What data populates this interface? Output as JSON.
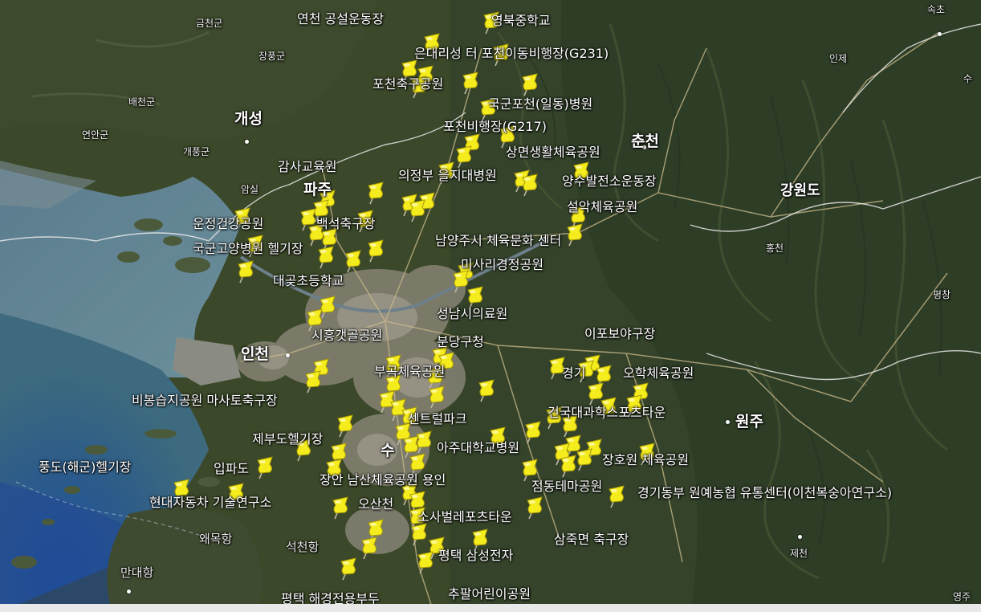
{
  "map": {
    "region_labels": [
      {
        "id": "sokcho",
        "text": "속초"
      },
      {
        "id": "inje",
        "text": "인제"
      },
      {
        "id": "yangpyeong",
        "text": "수"
      },
      {
        "id": "geumcheon",
        "text": "금천군"
      },
      {
        "id": "jangpung",
        "text": "장풍군"
      },
      {
        "id": "baecheon",
        "text": "배천군"
      },
      {
        "id": "yeonan",
        "text": "연안군"
      },
      {
        "id": "gaepung",
        "text": "개풍군"
      },
      {
        "id": "gaeseong",
        "text": "개성"
      },
      {
        "id": "chuncheon",
        "text": "춘천"
      },
      {
        "id": "gangwon",
        "text": "강원도"
      },
      {
        "id": "hongcheon",
        "text": "홍천"
      },
      {
        "id": "pyeongchang",
        "text": "평창"
      },
      {
        "id": "incheon",
        "text": "인천"
      },
      {
        "id": "wonju",
        "text": "원주"
      },
      {
        "id": "jecheon",
        "text": "제천"
      },
      {
        "id": "yeongju",
        "text": "영주"
      },
      {
        "id": "paju",
        "text": "파주"
      },
      {
        "id": "samsan",
        "text": "암실"
      },
      {
        "id": "suwon",
        "text": "수"
      }
    ],
    "poi_labels": [
      {
        "id": "yeoncheon",
        "text": "연천 공설운동장"
      },
      {
        "id": "yeongbuk",
        "text": "영북중학교"
      },
      {
        "id": "pocheon-g231",
        "text": "은대리성 터 포천이동비행장(G231)"
      },
      {
        "id": "pocheon-park",
        "text": "포천축구공원"
      },
      {
        "id": "army-hospital-pocheon",
        "text": "국군포천(일동)병원"
      },
      {
        "id": "pocheon-g217",
        "text": "포천비행장(G217)"
      },
      {
        "id": "sangmyeon",
        "text": "상면생활체육공원"
      },
      {
        "id": "gamsa",
        "text": "감사교육원"
      },
      {
        "id": "uijeongbu",
        "text": "의정부 을지대병원"
      },
      {
        "id": "yangsu",
        "text": "양수발전소운동장"
      },
      {
        "id": "seorak",
        "text": "설악체육공원"
      },
      {
        "id": "unjeong",
        "text": "운정건강공원"
      },
      {
        "id": "baekseok",
        "text": "백석축구장"
      },
      {
        "id": "namyangju",
        "text": "남양주시 체육문화 센터"
      },
      {
        "id": "goyang-heli",
        "text": "국군고양병원 헬기장"
      },
      {
        "id": "misa",
        "text": "미사리경정공원"
      },
      {
        "id": "daegot",
        "text": "대곶초등학교"
      },
      {
        "id": "seongnam",
        "text": "성남시의료원"
      },
      {
        "id": "siheung",
        "text": "시흥갯골공원"
      },
      {
        "id": "bundang",
        "text": "분당구청"
      },
      {
        "id": "ipo",
        "text": "이포보야구장"
      },
      {
        "id": "bugok",
        "text": "부곡체육공원"
      },
      {
        "id": "yeoju",
        "text": "경기"
      },
      {
        "id": "oh-hak",
        "text": "오학체육공원"
      },
      {
        "id": "bibong",
        "text": "비봉습지공원 마사토축구장"
      },
      {
        "id": "central",
        "text": "센트럴파크"
      },
      {
        "id": "konkuk",
        "text": "건국대과학스포츠타운"
      },
      {
        "id": "jebudo",
        "text": "제부도헬기장"
      },
      {
        "id": "ajou",
        "text": "아주대학교병원"
      },
      {
        "id": "pungdo",
        "text": "풍도(해군)헬기장"
      },
      {
        "id": "ippado",
        "text": "입파도"
      },
      {
        "id": "janghowon",
        "text": "장호원 체육공원"
      },
      {
        "id": "jangan",
        "text": "장안 남산체육공원 용인"
      },
      {
        "id": "jeomdong",
        "text": "점동테마공원"
      },
      {
        "id": "gyeonggi-east",
        "text": "경기동부 원예농협 유통센터(이천복숭아연구소)"
      },
      {
        "id": "hyundai",
        "text": "현대자동차 기술연구소"
      },
      {
        "id": "osan",
        "text": "오산천"
      },
      {
        "id": "sosabeol",
        "text": "소사벌레포츠타운"
      },
      {
        "id": "samjuk",
        "text": "삼죽면 축구장"
      },
      {
        "id": "waemok",
        "text": "왜목항"
      },
      {
        "id": "seokcheon",
        "text": "석천항"
      },
      {
        "id": "pyeongtaek-samsung",
        "text": "평택 삼성전자"
      },
      {
        "id": "mandae",
        "text": "만대항"
      },
      {
        "id": "pyeongtaek-pier",
        "text": "평택 해경전용부두"
      },
      {
        "id": "chupal",
        "text": "추팔어린이공원"
      }
    ],
    "pin_count": 100,
    "colors": {
      "pin": "#f5ec1e",
      "pin_dark": "#c9b800",
      "terrain": "#3d4a2b",
      "water": "#4a6f88",
      "urban": "#8a8578"
    }
  }
}
